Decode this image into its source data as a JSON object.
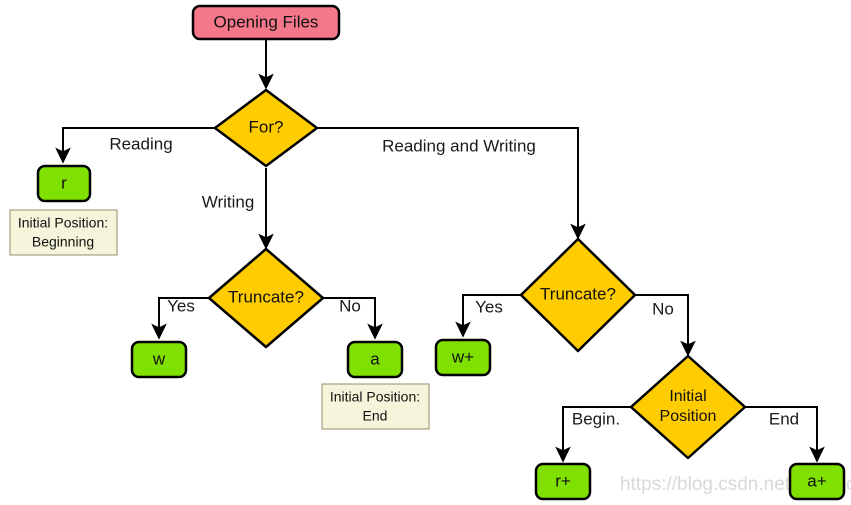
{
  "diagram": {
    "title": "Opening Files",
    "watermark": "https://blog.csdn.net/C_teacher",
    "colors": {
      "start_fill": "#F4788A",
      "decision_fill": "#FFCC00",
      "terminal_fill": "#80E000",
      "note_fill": "#F5F5DC",
      "note_stroke": "#8F8F6A",
      "edge": "#000000",
      "text": "#111111",
      "watermark": "#D9D9D9"
    },
    "nodes": {
      "start": {
        "label": "Opening Files",
        "shape": "rounded-rect",
        "kind": "start"
      },
      "for_decision": {
        "label": "For?",
        "shape": "diamond",
        "kind": "decision"
      },
      "truncate_write": {
        "label": "Truncate?",
        "shape": "diamond",
        "kind": "decision"
      },
      "truncate_rw": {
        "label": "Truncate?",
        "shape": "diamond",
        "kind": "decision"
      },
      "initial_position": {
        "label_line1": "Initial",
        "label_line2": "Position",
        "shape": "diamond",
        "kind": "decision"
      },
      "mode_r": {
        "label": "r",
        "shape": "rounded-rect",
        "kind": "terminal"
      },
      "mode_w": {
        "label": "w",
        "shape": "rounded-rect",
        "kind": "terminal"
      },
      "mode_a": {
        "label": "a",
        "shape": "rounded-rect",
        "kind": "terminal"
      },
      "mode_wplus": {
        "label": "w+",
        "shape": "rounded-rect",
        "kind": "terminal"
      },
      "mode_rplus": {
        "label": "r+",
        "shape": "rounded-rect",
        "kind": "terminal"
      },
      "mode_aplus": {
        "label": "a+",
        "shape": "rounded-rect",
        "kind": "terminal"
      }
    },
    "notes": {
      "note_r": {
        "line1": "Initial Position:",
        "line2": "Beginning"
      },
      "note_a": {
        "line1": "Initial Position:",
        "line2": "End"
      }
    },
    "edge_labels": {
      "reading": "Reading",
      "writing": "Writing",
      "reading_and_writing": "Reading and Writing",
      "truncate_write_yes": "Yes",
      "truncate_write_no": "No",
      "truncate_rw_yes": "Yes",
      "truncate_rw_no": "No",
      "position_begin": "Begin.",
      "position_end": "End"
    }
  }
}
